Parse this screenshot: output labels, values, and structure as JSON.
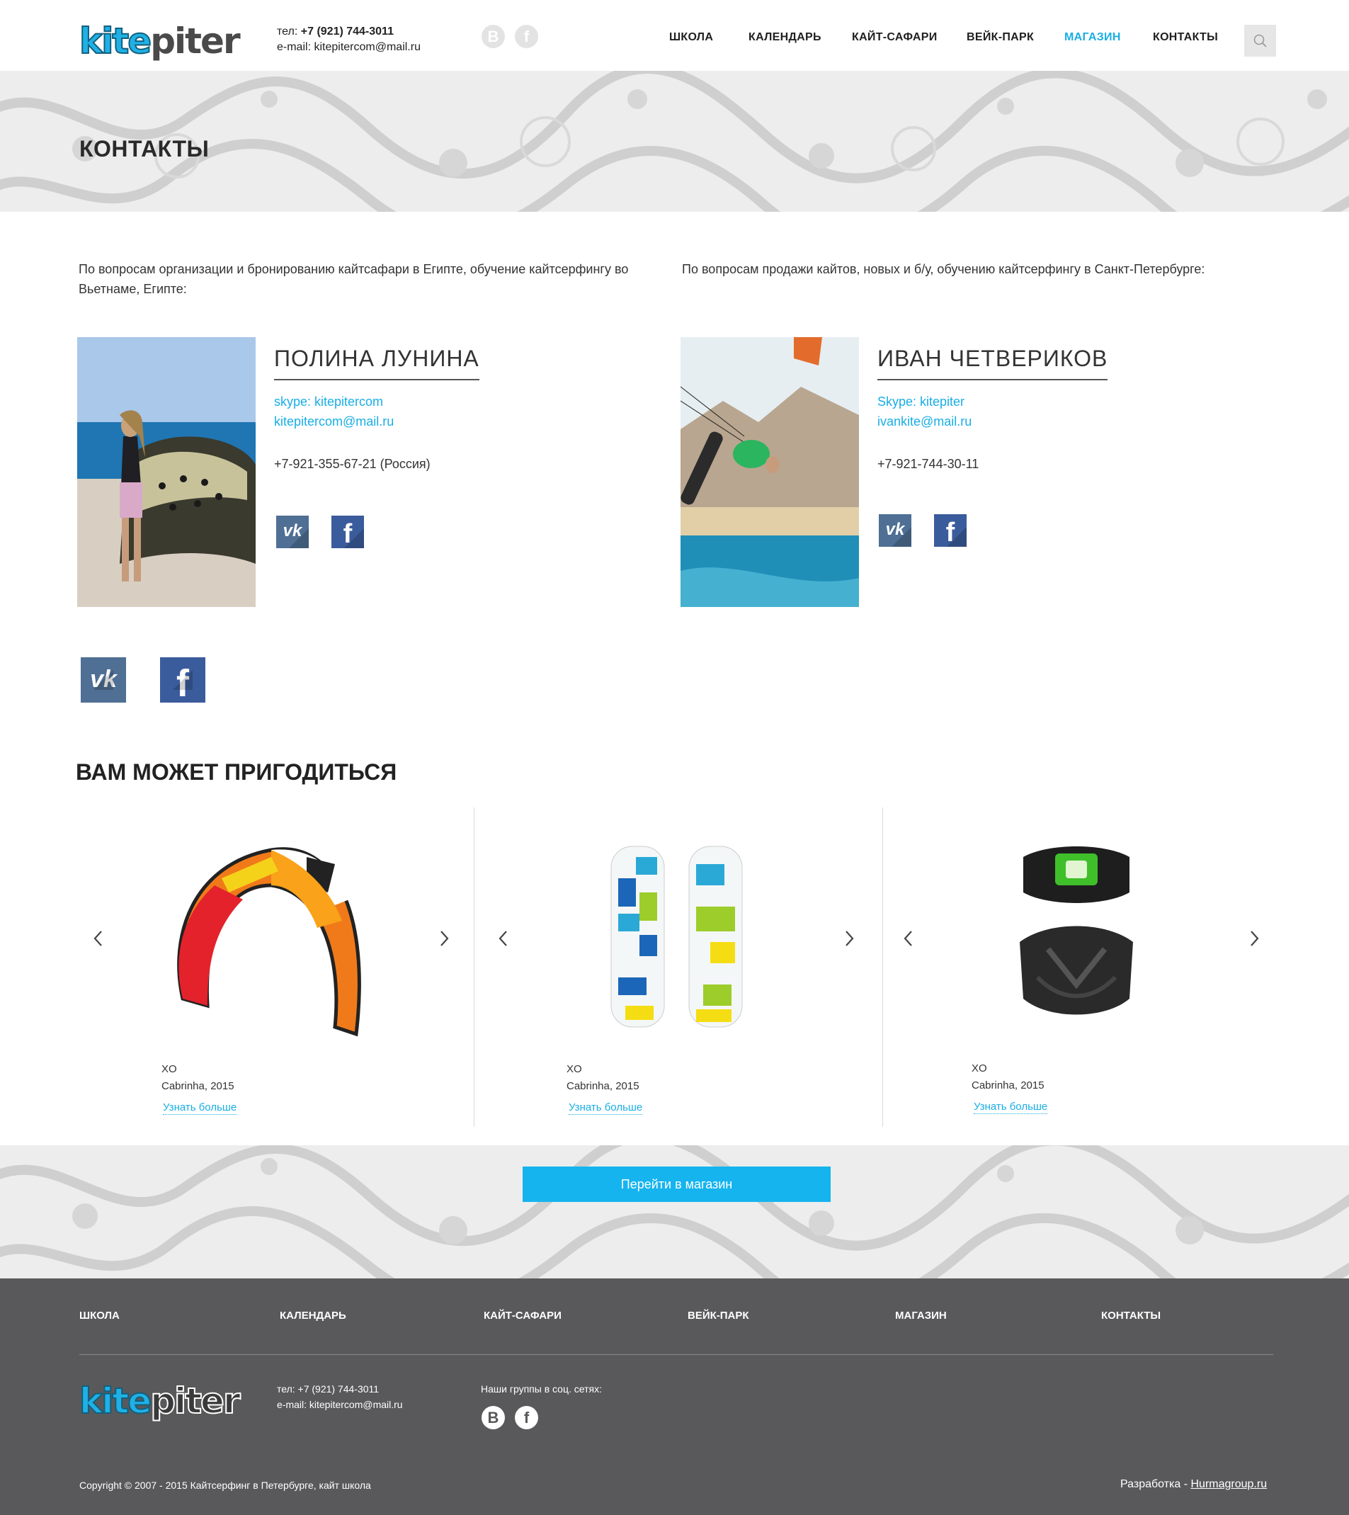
{
  "header": {
    "logo": "kitepiter",
    "phone_label": "тел:",
    "phone": "+7 (921) 744-3011",
    "email_label": "e-mail:",
    "email": "kitepitercom@mail.ru",
    "social": [
      "В",
      "f"
    ],
    "nav": [
      "ШКОЛА",
      "КАЛЕНДАРЬ",
      "КАЙТ-САФАРИ",
      "ВЕЙК-ПАРК",
      "МАГАЗИН",
      "КОНТАКТЫ"
    ],
    "active_nav": "МАГАЗИН"
  },
  "page_title": "КОНТАКТЫ",
  "intro": {
    "left": "По вопросам организации и бронированию кайтсафари в Египте, обучение кайтсерфингу во Вьетнаме, Египте:",
    "right": "По вопросам продажи кайтов, новых и б/у, обучению кайтсерфингу в Санкт-Петербурге:"
  },
  "persons": [
    {
      "name": "ПОЛИНА ЛУНИНА",
      "skype": "skype: kitepitercom",
      "email": "kitepitercom@mail.ru",
      "phone": "+7-921-355-67-21  (Россия)"
    },
    {
      "name": "ИВАН ЧЕТВЕРИКОВ",
      "skype": "Skype: kitepiter",
      "email": "ivankite@mail.ru",
      "phone": "+7-921-744-30-11"
    }
  ],
  "social_icons": {
    "vk": "vk",
    "fb": "f"
  },
  "section_title": "ВАМ МОЖЕТ ПРИГОДИТЬСЯ",
  "products": [
    {
      "name": "XO",
      "brand": "Cabrinha, 2015",
      "more": "Узнать больше",
      "icon": "kite"
    },
    {
      "name": "XO",
      "brand": "Cabrinha, 2015",
      "more": "Узнать больше",
      "icon": "wakeboard"
    },
    {
      "name": "XO",
      "brand": "Cabrinha, 2015",
      "more": "Узнать больше",
      "icon": "harness"
    }
  ],
  "shop_button": "Перейти в магазин",
  "footer": {
    "nav": [
      "ШКОЛА",
      "КАЛЕНДАРЬ",
      "КАЙТ-САФАРИ",
      "ВЕЙК-ПАРК",
      "МАГАЗИН",
      "КОНТАКТЫ"
    ],
    "logo": "kitepiter",
    "phone": "тел: +7 (921) 744-3011",
    "email": "e-mail: kitepitercom@mail.ru",
    "groups_label": "Наши группы в соц. сетях:",
    "social": [
      "В",
      "f"
    ],
    "copyright": "Copyright © 2007 - 2015 Кайтсерфинг в Петербурге, кайт школа",
    "dev_label": "Разработка - ",
    "dev_link": "Hurmagroup.ru"
  },
  "colors": {
    "accent": "#19aee5",
    "button": "#16b4ef",
    "footer": "#59595b",
    "vk": "#4f6f94",
    "fb": "#3b5c9c"
  }
}
